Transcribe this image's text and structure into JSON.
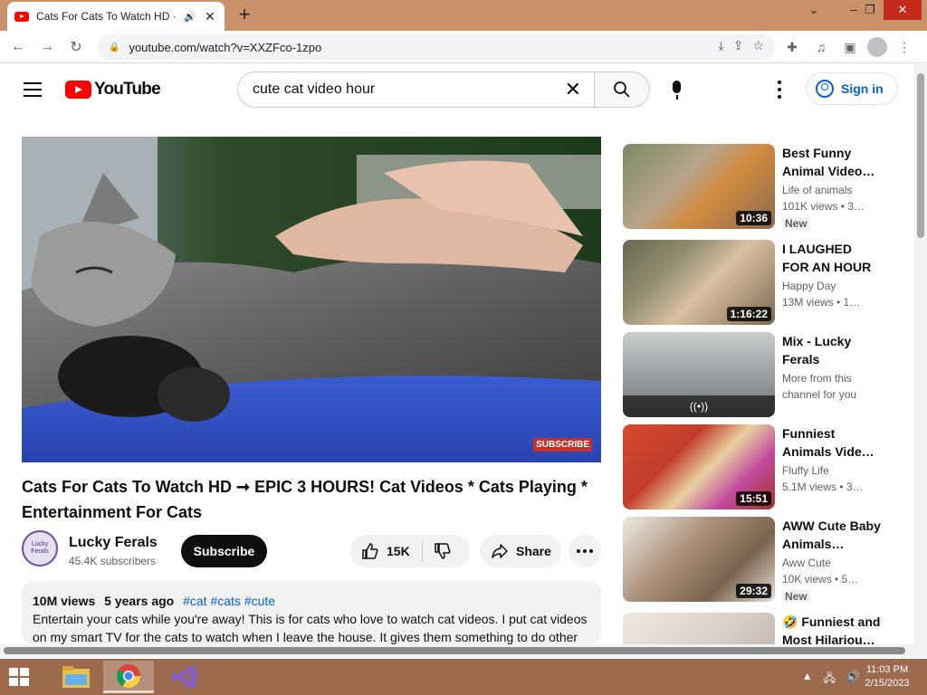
{
  "browser": {
    "tab_title": "Cats For Cats To Watch HD ·",
    "tab_audio_icon": "speaker-icon",
    "url": "youtube.com/watch?v=XXZFco-1zpo",
    "new_tab_label": "+"
  },
  "masthead": {
    "logo_text": "YouTube",
    "search_value": "cute cat video hour",
    "signin_label": "Sign in"
  },
  "video": {
    "watermark": "SUBSCRIBE",
    "title": "Cats For Cats To Watch HD ➞ EPIC 3 HOURS! Cat Videos * Cats Playing * Entertainment For Cats",
    "channel": "Lucky Ferals",
    "avatar_text": "Lucky Ferals",
    "subscribers": "45.4K subscribers",
    "subscribe_label": "Subscribe",
    "likes": "15K",
    "share_label": "Share"
  },
  "description": {
    "views": "10M views",
    "age": "5 years ago",
    "tags": "#cat #cats #cute",
    "text": "Entertain your cats while you're away! This is for cats who love to watch cat videos. I put cat videos on my smart TV for the cats to watch when I leave the house. It gives them something to do other"
  },
  "recommendations": [
    {
      "title": "Best Funny Animal Video…",
      "channel": "Life of animals",
      "views": "101K views  • 3…",
      "duration": "10:36",
      "badge": "New",
      "thumb_color": "#b7a48a"
    },
    {
      "title": "I LAUGHED FOR AN HOUR😹…",
      "channel": "Happy Day",
      "views": "13M views  • 1…",
      "duration": "1:16:22",
      "badge": "",
      "thumb_color": "#8e8a6e"
    },
    {
      "title": "Mix - Lucky Ferals",
      "channel": "More from this",
      "views": "channel for you",
      "duration": "",
      "mix_icon": "broadcast-icon",
      "badge": "",
      "thumb_color": "#9aa0a2"
    },
    {
      "title": "Funniest Animals Vide…",
      "channel": "Fluffy Life",
      "views": "5.1M views  • 3…",
      "duration": "15:51",
      "badge": "",
      "thumb_color": "#c23d2c"
    },
    {
      "title": "AWW Cute Baby Animals…",
      "channel": "Aww Cute",
      "views": "10K views  • 5…",
      "duration": "29:32",
      "badge": "New",
      "thumb_color": "#a8907a"
    },
    {
      "title": "🤣 Funniest and Most Hilariou…",
      "channel": "",
      "views": "",
      "duration": "",
      "badge": "",
      "thumb_color": "#d8cfc8"
    }
  ],
  "taskbar": {
    "time": "11:03 PM",
    "date": "2/15/2023"
  },
  "colors": {
    "youtube_red": "#ff0000",
    "link_blue": "#065fd4",
    "titlebar": "#c8916a",
    "taskbar": "#9c6a4c"
  }
}
